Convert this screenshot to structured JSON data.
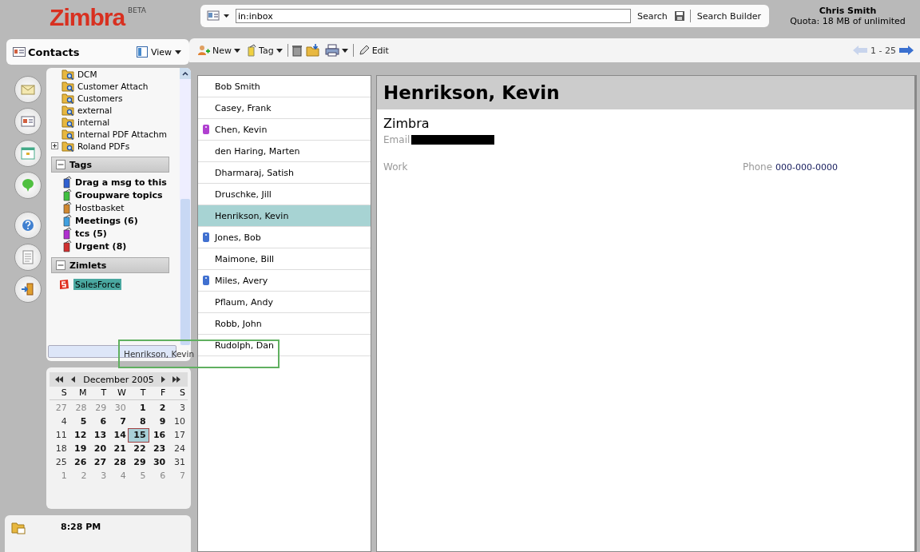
{
  "header": {
    "logo": "Zimbra",
    "logo_badge": "BETA",
    "search": {
      "value": "in:inbox"
    },
    "search_button": "Search",
    "search_builder": "Search Builder",
    "user": "Chris Smith",
    "quota": "Quota: 18 MB of unlimited"
  },
  "app": {
    "title": "Contacts",
    "view_button": "View"
  },
  "toolbar": {
    "new": "New",
    "tag": "Tag",
    "edit": "Edit",
    "pager": "1 - 25"
  },
  "folders": [
    {
      "label": "DCM",
      "kind": "leaf"
    },
    {
      "label": "Customer Attach",
      "kind": "leaf"
    },
    {
      "label": "Customers",
      "kind": "leaf"
    },
    {
      "label": "external",
      "kind": "leaf"
    },
    {
      "label": "internal",
      "kind": "leaf"
    },
    {
      "label": "Internal PDF Attachm",
      "kind": "leaf"
    },
    {
      "label": "Roland PDFs",
      "kind": "collapsed"
    }
  ],
  "tags_section": {
    "title": "Tags",
    "expanded": true
  },
  "tags": [
    {
      "label": "Drag a msg to this",
      "color": "#3060d0",
      "unread": true
    },
    {
      "label": "Groupware topics",
      "color": "#40c040",
      "unread": true
    },
    {
      "label": "Hostbasket",
      "color": "#d08830",
      "unread": false
    },
    {
      "label": "Meetings (6)",
      "color": "#40a0e0",
      "unread": true
    },
    {
      "label": "tcs (5)",
      "color": "#b030d0",
      "unread": true
    },
    {
      "label": "Urgent (8)",
      "color": "#d03030",
      "unread": true
    }
  ],
  "zimlets_section": {
    "title": "Zimlets",
    "expanded": true
  },
  "zimlets": [
    {
      "label": "SalesForce",
      "selected": true
    }
  ],
  "drag_ghost": "Henrikson, Kevin",
  "calendar": {
    "month": "December 2005",
    "weekdays": [
      "S",
      "M",
      "T",
      "W",
      "T",
      "F",
      "S"
    ],
    "weeks": [
      [
        {
          "day": "27",
          "kind": "other",
          "selected": false
        },
        {
          "day": "28",
          "kind": "other",
          "selected": false
        },
        {
          "day": "29",
          "kind": "other",
          "selected": false
        },
        {
          "day": "30",
          "kind": "other",
          "selected": false
        },
        {
          "day": "1",
          "kind": "weekday",
          "selected": false
        },
        {
          "day": "2",
          "kind": "weekday",
          "selected": false
        },
        {
          "day": "3",
          "kind": "weekend",
          "selected": false
        }
      ],
      [
        {
          "day": "4",
          "kind": "weekend",
          "selected": false
        },
        {
          "day": "5",
          "kind": "weekday",
          "selected": false
        },
        {
          "day": "6",
          "kind": "weekday",
          "selected": false
        },
        {
          "day": "7",
          "kind": "weekday",
          "selected": false
        },
        {
          "day": "8",
          "kind": "weekday",
          "selected": false
        },
        {
          "day": "9",
          "kind": "weekday",
          "selected": false
        },
        {
          "day": "10",
          "kind": "weekend",
          "selected": false
        }
      ],
      [
        {
          "day": "11",
          "kind": "weekend",
          "selected": false
        },
        {
          "day": "12",
          "kind": "weekday",
          "selected": false
        },
        {
          "day": "13",
          "kind": "weekday",
          "selected": false
        },
        {
          "day": "14",
          "kind": "weekday",
          "selected": false
        },
        {
          "day": "15",
          "kind": "weekday",
          "selected": true
        },
        {
          "day": "16",
          "kind": "weekday",
          "selected": false
        },
        {
          "day": "17",
          "kind": "weekend",
          "selected": false
        }
      ],
      [
        {
          "day": "18",
          "kind": "weekend",
          "selected": false
        },
        {
          "day": "19",
          "kind": "weekday",
          "selected": false
        },
        {
          "day": "20",
          "kind": "weekday",
          "selected": false
        },
        {
          "day": "21",
          "kind": "weekday",
          "selected": false
        },
        {
          "day": "22",
          "kind": "weekday",
          "selected": false
        },
        {
          "day": "23",
          "kind": "weekday",
          "selected": false
        },
        {
          "day": "24",
          "kind": "weekend",
          "selected": false
        }
      ],
      [
        {
          "day": "25",
          "kind": "weekend",
          "selected": false
        },
        {
          "day": "26",
          "kind": "weekday",
          "selected": false
        },
        {
          "day": "27",
          "kind": "weekday",
          "selected": false
        },
        {
          "day": "28",
          "kind": "weekday",
          "selected": false
        },
        {
          "day": "29",
          "kind": "weekday",
          "selected": false
        },
        {
          "day": "30",
          "kind": "weekday",
          "selected": false
        },
        {
          "day": "31",
          "kind": "weekend",
          "selected": false
        }
      ],
      [
        {
          "day": "1",
          "kind": "other",
          "selected": false
        },
        {
          "day": "2",
          "kind": "other",
          "selected": false
        },
        {
          "day": "3",
          "kind": "other",
          "selected": false
        },
        {
          "day": "4",
          "kind": "other",
          "selected": false
        },
        {
          "day": "5",
          "kind": "other",
          "selected": false
        },
        {
          "day": "6",
          "kind": "other",
          "selected": false
        },
        {
          "day": "7",
          "kind": "other",
          "selected": false
        }
      ]
    ]
  },
  "clock": "8:28 PM",
  "contacts": [
    {
      "name": "Bob Smith",
      "selected": false
    },
    {
      "name": "Casey, Frank",
      "selected": false
    },
    {
      "name": "Chen, Kevin",
      "selected": false,
      "color": "#b040d0"
    },
    {
      "name": "den Haring, Marten",
      "selected": false
    },
    {
      "name": "Dharmaraj, Satish",
      "selected": false
    },
    {
      "name": "Druschke, Jill",
      "selected": false
    },
    {
      "name": "Henrikson, Kevin",
      "selected": true
    },
    {
      "name": "Jones, Bob",
      "selected": false,
      "color": "#4070d0"
    },
    {
      "name": "Maimone, Bill",
      "selected": false
    },
    {
      "name": "Miles, Avery",
      "selected": false,
      "color": "#4070d0"
    },
    {
      "name": "Pflaum, Andy",
      "selected": false
    },
    {
      "name": "Robb, John",
      "selected": false
    },
    {
      "name": "Rudolph, Dan",
      "selected": false
    }
  ],
  "detail": {
    "name": "Henrikson, Kevin",
    "company": "Zimbra",
    "email_label": "Email",
    "section": "Work",
    "phone_label": "Phone",
    "phone": "000-000-0000"
  }
}
